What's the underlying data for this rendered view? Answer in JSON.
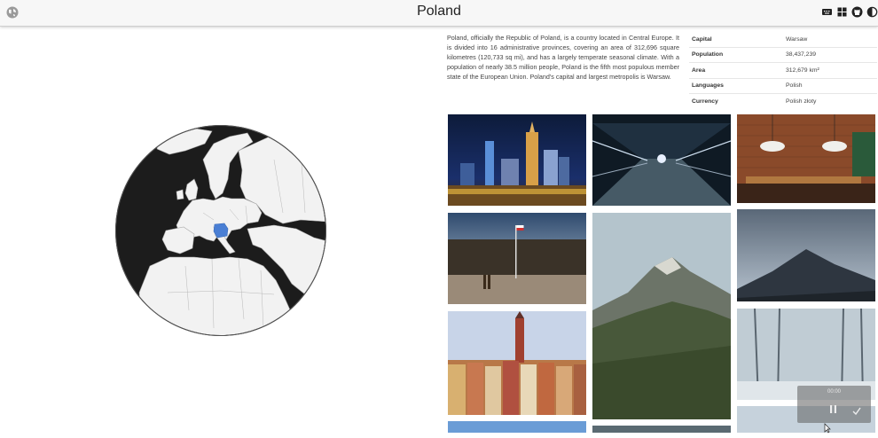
{
  "header": {
    "title": "Poland",
    "left_icon": "globe-icon",
    "right_icons": [
      "keyboard-icon",
      "grid-icon",
      "github-icon",
      "theme-icon"
    ]
  },
  "description": "Poland, officially the Republic of Poland, is a country located in Central Europe. It is divided into 16 administrative provinces, covering an area of 312,696 square kilometres (120,733 sq mi), and has a largely temperate seasonal climate. With a population of nearly 38.5 million people, Poland is the fifth most populous member state of the European Union. Poland's capital and largest metropolis is Warsaw.",
  "facts": [
    {
      "key": "Capital",
      "value": "Warsaw"
    },
    {
      "key": "Population",
      "value": "38,437,239"
    },
    {
      "key": "Area",
      "value": "312,679 km²"
    },
    {
      "key": "Languages",
      "value": "Polish"
    },
    {
      "key": "Currency",
      "value": "Polish złoty"
    }
  ],
  "map": {
    "highlight_country": "Poland",
    "highlight_color": "#4a7fd4",
    "land_color": "#f2f2f2",
    "ocean_color": "#1c1c1c"
  },
  "photos": [
    {
      "name": "photo-warsaw-skyline-night"
    },
    {
      "name": "photo-airport-walkway"
    },
    {
      "name": "photo-brick-cafe-interior"
    },
    {
      "name": "photo-square-with-flag"
    },
    {
      "name": "photo-mountain-ridge"
    },
    {
      "name": "photo-dark-mountain-peak"
    },
    {
      "name": "photo-old-town-houses"
    },
    {
      "name": "photo-misty-winter-forest"
    },
    {
      "name": "photo-partial-bottom-1"
    },
    {
      "name": "photo-partial-bottom-2"
    },
    {
      "name": "photo-partial-bottom-3"
    }
  ],
  "recorder": {
    "time": "00:00",
    "pause_icon": "pause-icon",
    "confirm_icon": "check-icon"
  }
}
